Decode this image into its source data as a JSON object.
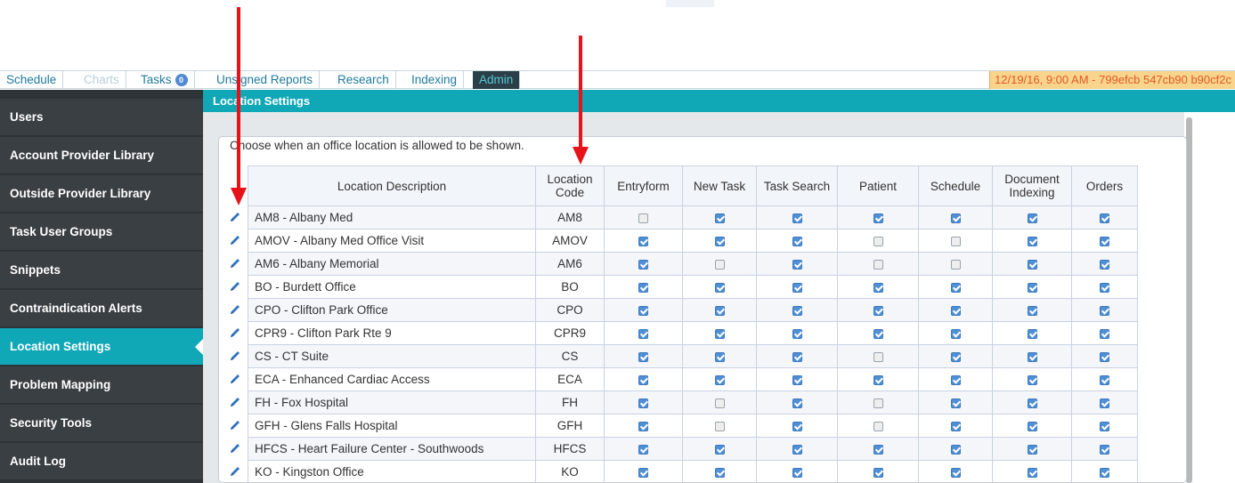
{
  "tabs": [
    {
      "label": "Schedule",
      "state": "normal"
    },
    {
      "label": "Charts",
      "state": "disabled"
    },
    {
      "label": "Tasks",
      "state": "normal",
      "badge": "0"
    },
    {
      "label": "Unsigned Reports",
      "state": "normal"
    },
    {
      "label": "Research",
      "state": "normal"
    },
    {
      "label": "Indexing",
      "state": "normal"
    },
    {
      "label": "Admin",
      "state": "active"
    }
  ],
  "session": {
    "text": "12/19/16, 9:00 AM - 799efcb 547cb90 b90cf2c"
  },
  "sidebar": {
    "items": [
      {
        "label": "Users"
      },
      {
        "label": "Account Provider Library"
      },
      {
        "label": "Outside Provider Library"
      },
      {
        "label": "Task User Groups"
      },
      {
        "label": "Snippets"
      },
      {
        "label": "Contraindication Alerts"
      },
      {
        "label": "Location Settings",
        "active": true
      },
      {
        "label": "Problem Mapping"
      },
      {
        "label": "Security Tools"
      },
      {
        "label": "Audit Log"
      }
    ]
  },
  "page": {
    "title": "Location Settings",
    "intro": "Choose when an office location is allowed to be shown."
  },
  "table": {
    "headers": {
      "description": "Location Description",
      "code_line1": "Location",
      "code_line2": "Code",
      "entryform": "Entryform",
      "new_task": "New Task",
      "task_search": "Task Search",
      "patient": "Patient",
      "schedule": "Schedule",
      "doc_line1": "Document",
      "doc_line2": "Indexing",
      "orders": "Orders"
    },
    "rows": [
      {
        "desc": "AM8 - Albany Med",
        "code": "AM8",
        "flags": [
          false,
          true,
          true,
          true,
          true,
          true,
          true
        ]
      },
      {
        "desc": "AMOV - Albany Med Office Visit",
        "code": "AMOV",
        "flags": [
          true,
          true,
          true,
          false,
          false,
          true,
          true
        ]
      },
      {
        "desc": "AM6 - Albany Memorial",
        "code": "AM6",
        "flags": [
          true,
          false,
          true,
          false,
          false,
          true,
          true
        ]
      },
      {
        "desc": "BO - Burdett Office",
        "code": "BO",
        "flags": [
          true,
          true,
          true,
          true,
          true,
          true,
          true
        ]
      },
      {
        "desc": "CPO - Clifton Park Office",
        "code": "CPO",
        "flags": [
          true,
          true,
          true,
          true,
          true,
          true,
          true
        ]
      },
      {
        "desc": "CPR9 - Clifton Park Rte 9",
        "code": "CPR9",
        "flags": [
          true,
          true,
          true,
          true,
          true,
          true,
          true
        ]
      },
      {
        "desc": "CS - CT Suite",
        "code": "CS",
        "flags": [
          true,
          true,
          true,
          false,
          true,
          true,
          true
        ]
      },
      {
        "desc": "ECA - Enhanced Cardiac Access",
        "code": "ECA",
        "flags": [
          true,
          true,
          true,
          true,
          true,
          true,
          true
        ]
      },
      {
        "desc": "FH - Fox Hospital",
        "code": "FH",
        "flags": [
          true,
          false,
          true,
          false,
          true,
          true,
          true
        ]
      },
      {
        "desc": "GFH - Glens Falls Hospital",
        "code": "GFH",
        "flags": [
          true,
          false,
          true,
          false,
          true,
          true,
          true
        ]
      },
      {
        "desc": "HFCS - Heart Failure Center - Southwoods",
        "code": "HFCS",
        "flags": [
          true,
          true,
          true,
          true,
          true,
          true,
          true
        ]
      },
      {
        "desc": "KO - Kingston Office",
        "code": "KO",
        "flags": [
          true,
          true,
          true,
          true,
          true,
          true,
          true
        ]
      }
    ]
  },
  "colors": {
    "accent": "#10a8b7",
    "sidebar": "#3a3f43",
    "checkbox_on": "#4f8fd6",
    "annotation_arrow": "#e8121a"
  }
}
